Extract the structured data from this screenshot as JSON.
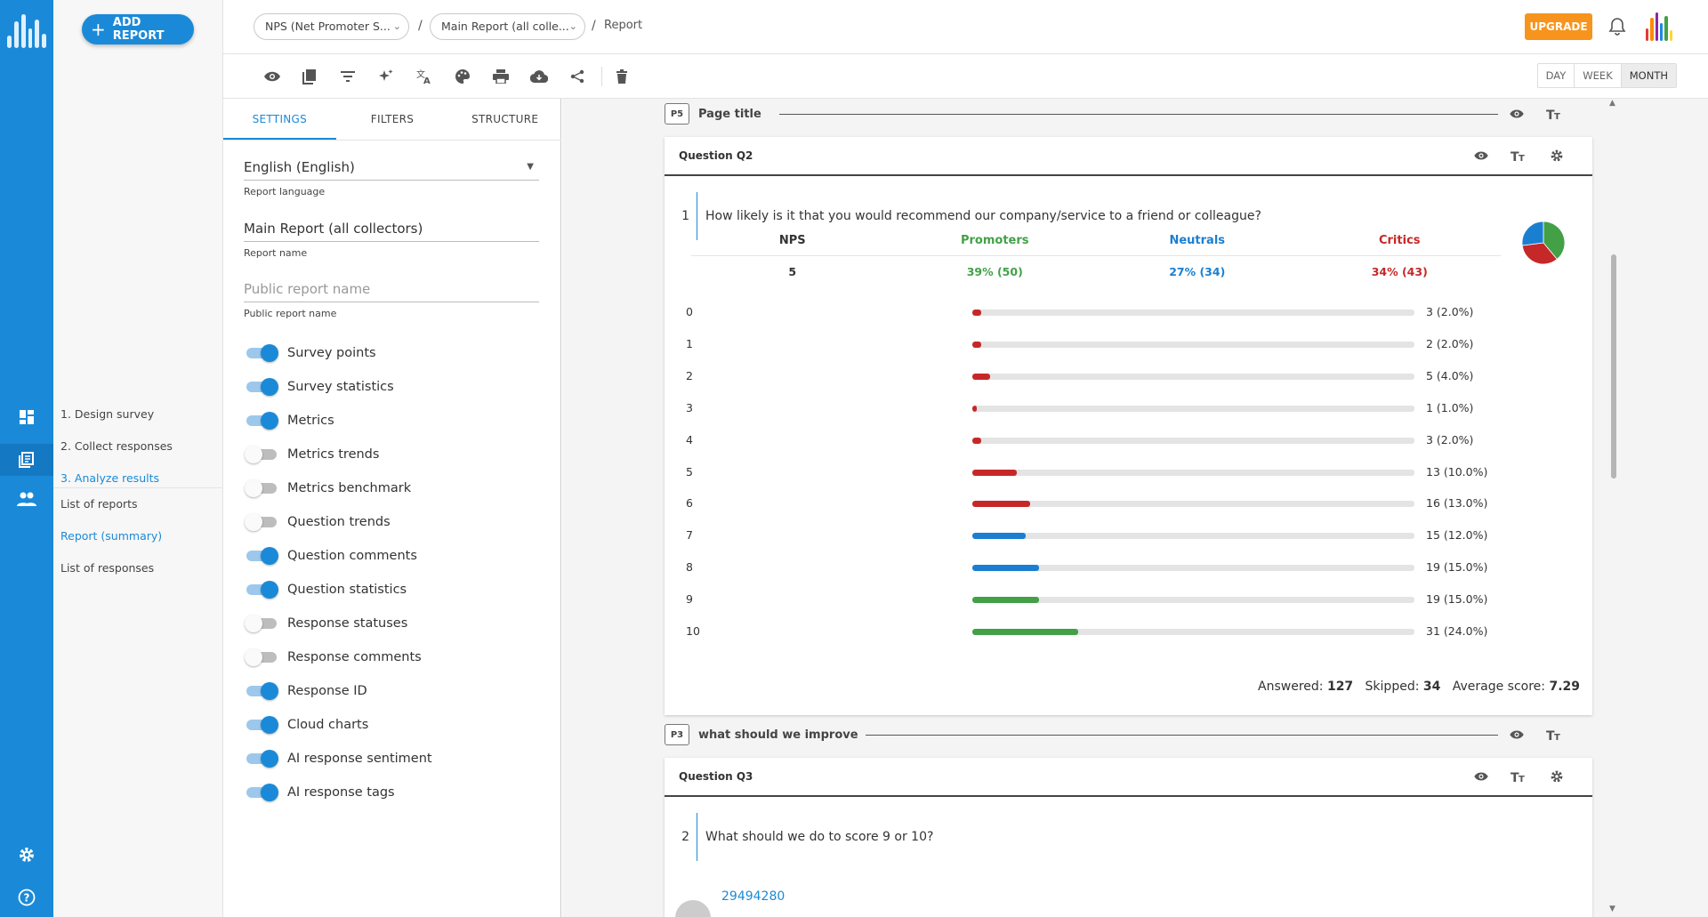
{
  "app": {
    "add_report_label": "ADD REPORT",
    "upgrade_label": "UPGRADE"
  },
  "breadcrumb": {
    "survey": "NPS (Net Promoter S...",
    "report": "Main Report (all colle...",
    "sep1": "/",
    "sep2": "/",
    "current": "Report"
  },
  "steps": [
    {
      "label": "1. Design survey"
    },
    {
      "label": "2. Collect responses"
    },
    {
      "label": "3. Analyze results"
    }
  ],
  "subnav": [
    {
      "label": "List of reports"
    },
    {
      "label": "Report (summary)"
    },
    {
      "label": "List of responses"
    }
  ],
  "range": [
    "DAY",
    "WEEK",
    "MONTH"
  ],
  "tabs": [
    "SETTINGS",
    "FILTERS",
    "STRUCTURE"
  ],
  "fields": {
    "language": {
      "value": "English (English)",
      "label": "Report language"
    },
    "name": {
      "value": "Main Report (all collectors)",
      "label": "Report name"
    },
    "public_name": {
      "placeholder": "Public report name",
      "label": "Public report name"
    }
  },
  "toggles": [
    {
      "label": "Survey points",
      "on": true
    },
    {
      "label": "Survey statistics",
      "on": true
    },
    {
      "label": "Metrics",
      "on": true
    },
    {
      "label": "Metrics trends",
      "on": false
    },
    {
      "label": "Metrics benchmark",
      "on": false
    },
    {
      "label": "Question trends",
      "on": false
    },
    {
      "label": "Question comments",
      "on": true
    },
    {
      "label": "Question statistics",
      "on": true
    },
    {
      "label": "Response statuses",
      "on": false
    },
    {
      "label": "Response comments",
      "on": false
    },
    {
      "label": "Response ID",
      "on": true
    },
    {
      "label": "Cloud charts",
      "on": true
    },
    {
      "label": "AI response sentiment",
      "on": true
    },
    {
      "label": "AI response tags",
      "on": true
    }
  ],
  "page_p5": {
    "badge": "P5",
    "title": "Page title"
  },
  "page_p3": {
    "badge": "P3",
    "title": "what should we improve"
  },
  "q2": {
    "header": "Question Q2",
    "num": "1",
    "text": "How likely is it that you would recommend our company/service to a friend or colleague?",
    "nps_headers": [
      "NPS",
      "Promoters",
      "Neutrals",
      "Critics"
    ],
    "nps_values": [
      "5",
      "39% (50)",
      "27% (34)",
      "34% (43)"
    ],
    "answered_label": "Answered:",
    "answered": "127",
    "skipped_label": "Skipped:",
    "skipped": "34",
    "avg_label": "Average score:",
    "avg": "7.29"
  },
  "q3": {
    "header": "Question Q3",
    "num": "2",
    "text": "What should we do to score 9 or 10?",
    "response_id": "29494280"
  },
  "colors": {
    "accent": "#1a8ad8",
    "promoter": "#43a047",
    "neutral": "#1a7fd1",
    "critic": "#c62828",
    "upgrade": "#f7941d"
  },
  "chart_data": {
    "type": "bar",
    "categories": [
      "0",
      "1",
      "2",
      "3",
      "4",
      "5",
      "6",
      "7",
      "8",
      "9",
      "10"
    ],
    "values": [
      3,
      2,
      5,
      1,
      3,
      13,
      16,
      15,
      19,
      19,
      31
    ],
    "labels": [
      "3 (2.0%)",
      "2 (2.0%)",
      "5 (4.0%)",
      "1 (1.0%)",
      "3 (2.0%)",
      "13 (10.0%)",
      "16 (13.0%)",
      "15 (12.0%)",
      "19 (15.0%)",
      "19 (15.0%)",
      "31 (24.0%)"
    ],
    "percent": [
      2,
      2,
      4,
      1,
      2,
      10,
      13,
      12,
      15,
      15,
      24
    ],
    "groups": [
      "critic",
      "critic",
      "critic",
      "critic",
      "critic",
      "critic",
      "critic",
      "neutral",
      "neutral",
      "promoter",
      "promoter"
    ],
    "pie": [
      {
        "name": "Promoters",
        "value": 39
      },
      {
        "name": "Neutrals",
        "value": 27
      },
      {
        "name": "Critics",
        "value": 34
      }
    ]
  }
}
